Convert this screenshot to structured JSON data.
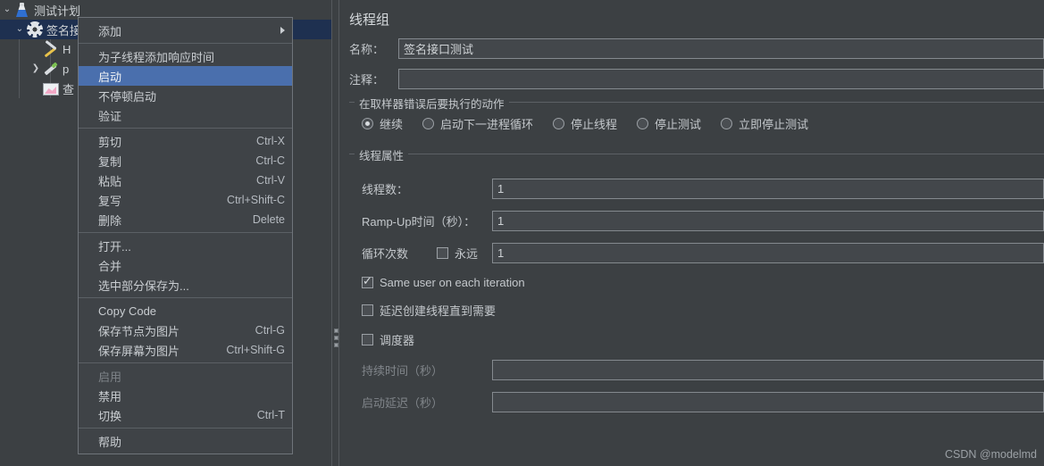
{
  "tree": {
    "items": [
      {
        "label": "测试计划",
        "icon": "flask-icon",
        "twisty": "expanded",
        "indent": 0,
        "selected": false
      },
      {
        "label": "签名接口测试",
        "icon": "gear-icon",
        "twisty": "expanded",
        "indent": 1,
        "selected": true
      },
      {
        "label": "H",
        "icon": "tools-icon",
        "twisty": "none",
        "indent": 2,
        "selected": false
      },
      {
        "label": "p",
        "icon": "pencil-icon",
        "twisty": "collapsed",
        "indent": 2,
        "selected": false
      },
      {
        "label": "查",
        "icon": "chart-icon",
        "twisty": "none",
        "indent": 2,
        "selected": false
      }
    ]
  },
  "context_menu": {
    "items": [
      {
        "label": "添加",
        "accel": "",
        "submenu": true,
        "highlighted": false,
        "disabled": false
      },
      {
        "separator": true
      },
      {
        "label": "为子线程添加响应时间",
        "accel": "",
        "submenu": false,
        "highlighted": false,
        "disabled": false
      },
      {
        "label": "启动",
        "accel": "",
        "submenu": false,
        "highlighted": true,
        "disabled": false
      },
      {
        "label": "不停顿启动",
        "accel": "",
        "submenu": false,
        "highlighted": false,
        "disabled": false
      },
      {
        "label": "验证",
        "accel": "",
        "submenu": false,
        "highlighted": false,
        "disabled": false
      },
      {
        "separator": true
      },
      {
        "label": "剪切",
        "accel": "Ctrl-X",
        "submenu": false,
        "highlighted": false,
        "disabled": false
      },
      {
        "label": "复制",
        "accel": "Ctrl-C",
        "submenu": false,
        "highlighted": false,
        "disabled": false
      },
      {
        "label": "粘贴",
        "accel": "Ctrl-V",
        "submenu": false,
        "highlighted": false,
        "disabled": false
      },
      {
        "label": "复写",
        "accel": "Ctrl+Shift-C",
        "submenu": false,
        "highlighted": false,
        "disabled": false
      },
      {
        "label": "删除",
        "accel": "Delete",
        "submenu": false,
        "highlighted": false,
        "disabled": false
      },
      {
        "separator": true
      },
      {
        "label": "打开...",
        "accel": "",
        "submenu": false,
        "highlighted": false,
        "disabled": false
      },
      {
        "label": "合并",
        "accel": "",
        "submenu": false,
        "highlighted": false,
        "disabled": false
      },
      {
        "label": "选中部分保存为...",
        "accel": "",
        "submenu": false,
        "highlighted": false,
        "disabled": false
      },
      {
        "separator": true
      },
      {
        "label": "Copy Code",
        "accel": "",
        "submenu": false,
        "highlighted": false,
        "disabled": false
      },
      {
        "label": "保存节点为图片",
        "accel": "Ctrl-G",
        "submenu": false,
        "highlighted": false,
        "disabled": false
      },
      {
        "label": "保存屏幕为图片",
        "accel": "Ctrl+Shift-G",
        "submenu": false,
        "highlighted": false,
        "disabled": false
      },
      {
        "separator": true
      },
      {
        "label": "启用",
        "accel": "",
        "submenu": false,
        "highlighted": false,
        "disabled": true
      },
      {
        "label": "禁用",
        "accel": "",
        "submenu": false,
        "highlighted": false,
        "disabled": false
      },
      {
        "label": "切换",
        "accel": "Ctrl-T",
        "submenu": false,
        "highlighted": false,
        "disabled": false
      },
      {
        "separator": true
      },
      {
        "label": "帮助",
        "accel": "",
        "submenu": false,
        "highlighted": false,
        "disabled": false
      }
    ]
  },
  "form": {
    "title": "线程组",
    "name_label": "名称：",
    "name_value": "签名接口测试",
    "comment_label": "注释：",
    "comment_value": "",
    "error_action": {
      "group_title": "在取样器错误后要执行的动作",
      "options": [
        {
          "label": "继续",
          "selected": true
        },
        {
          "label": "启动下一进程循环",
          "selected": false
        },
        {
          "label": "停止线程",
          "selected": false
        },
        {
          "label": "停止测试",
          "selected": false
        },
        {
          "label": "立即停止测试",
          "selected": false
        }
      ]
    },
    "thread_props": {
      "group_title": "线程属性",
      "threads_label": "线程数：",
      "threads_value": "1",
      "rampup_label": "Ramp-Up时间（秒）：",
      "rampup_value": "1",
      "loop_label": "循环次数",
      "forever_label": "永远",
      "forever_checked": false,
      "loop_value": "1",
      "same_user_label": "Same user on each iteration",
      "same_user_checked": true,
      "delay_create_label": "延迟创建线程直到需要",
      "delay_create_checked": false,
      "scheduler_label": "调度器",
      "scheduler_checked": false,
      "duration_label": "持续时间（秒）",
      "duration_value": "",
      "startup_delay_label": "启动延迟（秒）",
      "startup_delay_value": ""
    }
  },
  "watermark": "CSDN @modelmd",
  "colors": {
    "app_bg": "#3c4043",
    "menu_bg": "#3f4347",
    "menu_highlight": "#4a6fad",
    "tree_selection": "#1e3050",
    "input_bg": "#43474b",
    "border": "#84898e"
  }
}
